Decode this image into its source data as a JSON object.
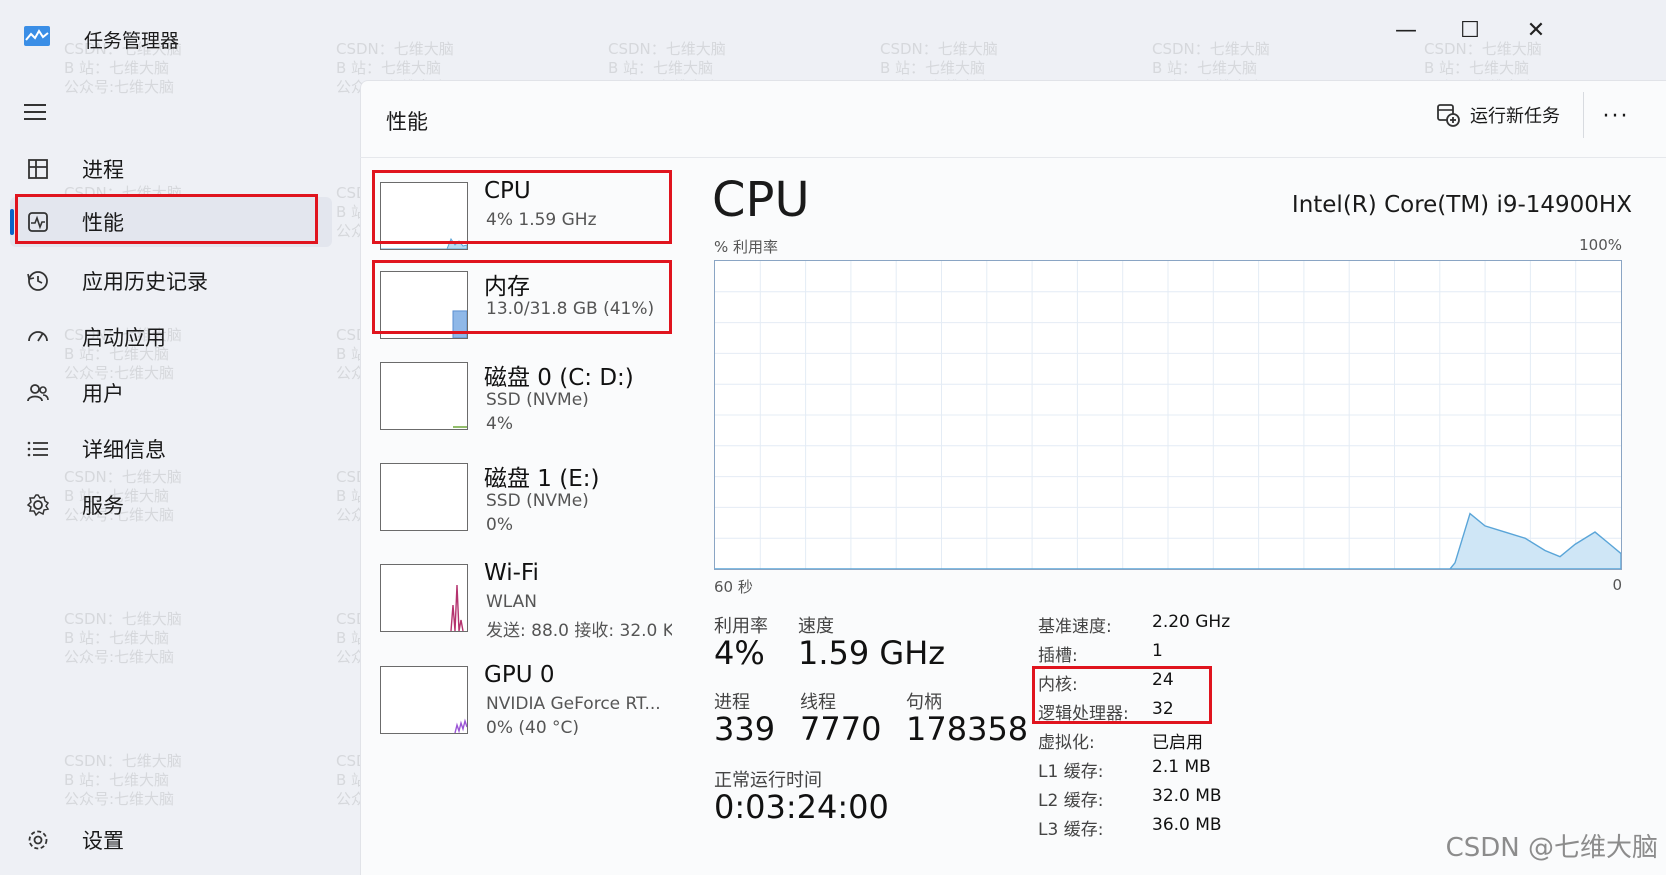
{
  "window": {
    "title": "任务管理器",
    "minimize": "—",
    "maximize": "☐",
    "close": "✕"
  },
  "sidebar": {
    "items": [
      {
        "label": "进程"
      },
      {
        "label": "性能"
      },
      {
        "label": "应用历史记录"
      },
      {
        "label": "启动应用"
      },
      {
        "label": "用户"
      },
      {
        "label": "详细信息"
      },
      {
        "label": "服务"
      }
    ],
    "settings_label": "设置",
    "active_index": 1
  },
  "header": {
    "page_title": "性能",
    "run_task_label": "运行新任务",
    "more_label": "···"
  },
  "devices": [
    {
      "name": "CPU",
      "sub1": "4%  1.59 GHz",
      "sub2": "",
      "usage": 0.04
    },
    {
      "name": "内存",
      "sub1": "13.0/31.8 GB (41%)",
      "sub2": "",
      "usage": 0.41
    },
    {
      "name": "磁盘 0 (C: D:)",
      "sub1": "SSD (NVMe)",
      "sub2": "4%",
      "usage": 0.04
    },
    {
      "name": "磁盘 1 (E:)",
      "sub1": "SSD (NVMe)",
      "sub2": "0%",
      "usage": 0.0
    },
    {
      "name": "Wi-Fi",
      "sub1": "WLAN",
      "sub2": "发送: 88.0  接收: 32.0 K",
      "usage": 0.0
    },
    {
      "name": "GPU 0",
      "sub1": "NVIDIA GeForce RT...",
      "sub2": "0%  (40 °C)",
      "usage": 0.0
    }
  ],
  "cpu": {
    "title": "CPU",
    "model": "Intel(R) Core(TM) i9-14900HX",
    "graph_label_left": "% 利用率",
    "graph_label_right": "100%",
    "time_label": "60 秒",
    "zero_label": "0",
    "utilization_label": "利用率",
    "utilization": "4%",
    "speed_label": "速度",
    "speed": "1.59 GHz",
    "processes_label": "进程",
    "processes": "339",
    "threads_label": "线程",
    "threads": "7770",
    "handles_label": "句柄",
    "handles": "178358",
    "uptime_label": "正常运行时间",
    "uptime": "0:03:24:00",
    "specs": [
      {
        "k": "基准速度:",
        "v": "2.20 GHz"
      },
      {
        "k": "插槽:",
        "v": "1"
      },
      {
        "k": "内核:",
        "v": "24"
      },
      {
        "k": "逻辑处理器:",
        "v": "32"
      },
      {
        "k": "虚拟化:",
        "v": "已启用"
      },
      {
        "k": "L1 缓存:",
        "v": "2.1 MB"
      },
      {
        "k": "L2 缓存:",
        "v": "32.0 MB"
      },
      {
        "k": "L3 缓存:",
        "v": "36.0 MB"
      }
    ]
  },
  "watermark": {
    "line1": "CSDN：七维大脑",
    "line2": "B 站：七维大脑",
    "line3": "公众号:七维大脑",
    "brand": "CSDN @七维大脑"
  },
  "colors": {
    "accent": "#0a64c8",
    "highlight": "#e0141e",
    "cpu_graph": "#5aa5d8",
    "mem_graph": "#8fb8e8"
  }
}
